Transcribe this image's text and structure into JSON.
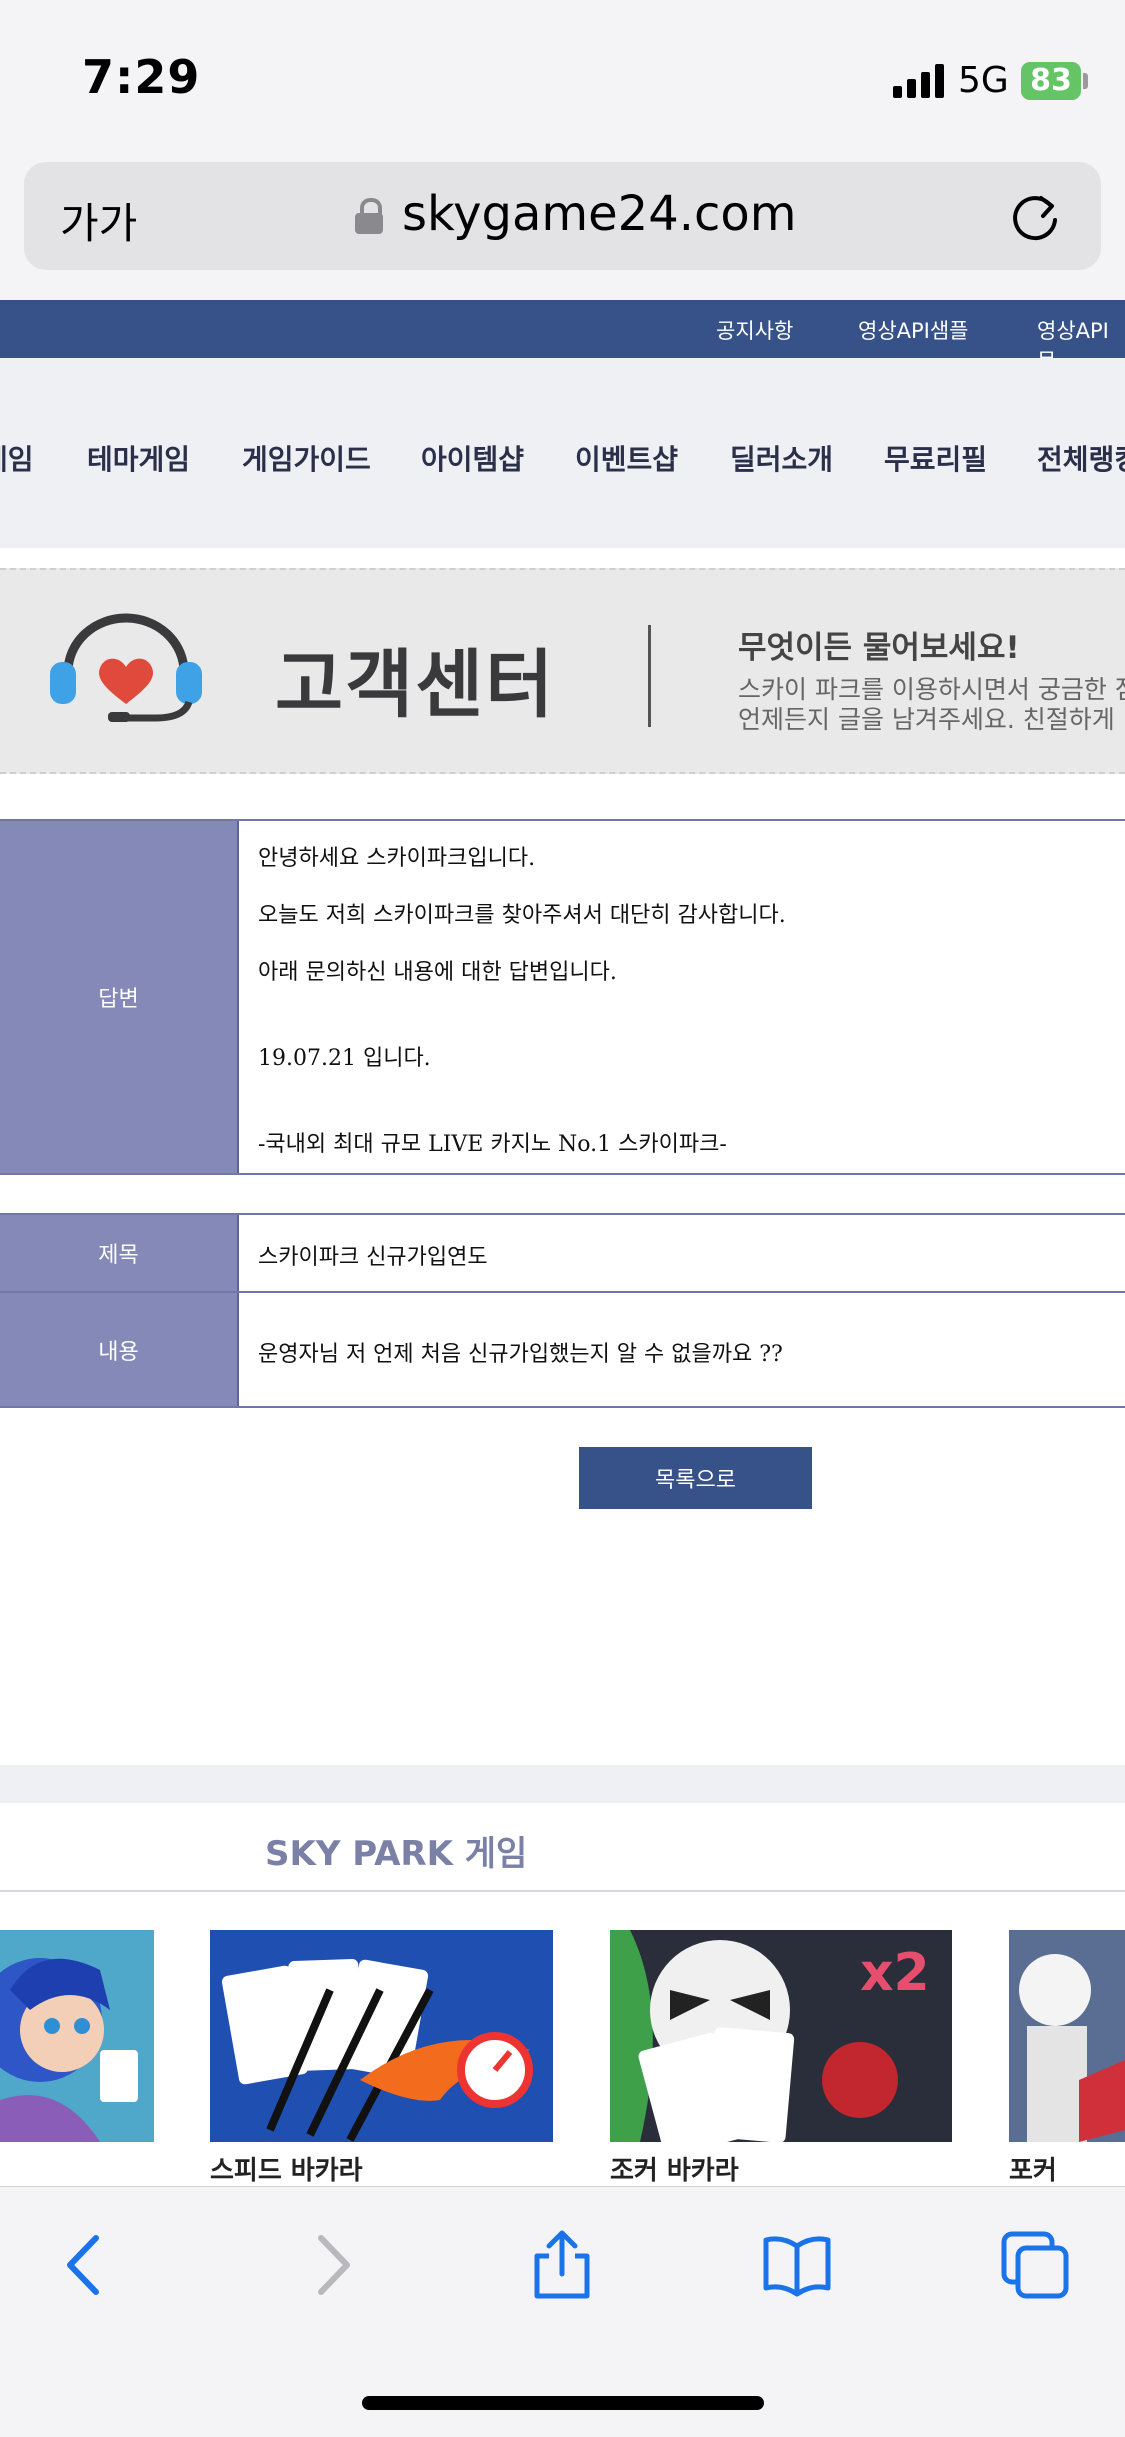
{
  "status_bar": {
    "time": "7:29",
    "network": "5G",
    "battery": "83"
  },
  "browser": {
    "text_size_label": "가가",
    "url": "skygame24.com"
  },
  "top_nav": {
    "items": [
      "공지사항",
      "영상API샘플",
      "영상API문"
    ]
  },
  "main_menu": {
    "items": [
      "게임",
      "테마게임",
      "게임가이드",
      "아이템샵",
      "이벤트샵",
      "딜러소개",
      "무료리필",
      "전체랭킹"
    ]
  },
  "banner": {
    "title": "고객센터",
    "headline": "무엇이든 물어보세요!",
    "subtext_line1": "스카이 파크를 이용하시면서 궁금한 점이",
    "subtext_line2": "언제든지 글을 남겨주세요. 친절하게 답"
  },
  "answer": {
    "label": "답변",
    "lines": [
      "안녕하세요 스카이파크입니다.",
      "오늘도 저희 스카이파크를 찾아주셔서 대단히 감사합니다.",
      "아래 문의하신 내용에 대한 답변입니다.",
      "19.07.21 입니다.",
      "-국내외 최대 규모 LIVE 카지노 No.1 스카이파크-"
    ]
  },
  "inquiry": {
    "subject_label": "제목",
    "subject": "스카이파크 신규가입연도",
    "content_label": "내용",
    "content": "운영자님 저 언제 처음 신규가입했는지 알 수 없을까요 ??"
  },
  "list_button": "목록으로",
  "games_section": {
    "title": "SKY PARK 게임",
    "games": [
      "스피드 바카라",
      "조커 바카라",
      "포커"
    ]
  },
  "colors": {
    "brand": "#365289",
    "label_bg": "#8489b8"
  }
}
